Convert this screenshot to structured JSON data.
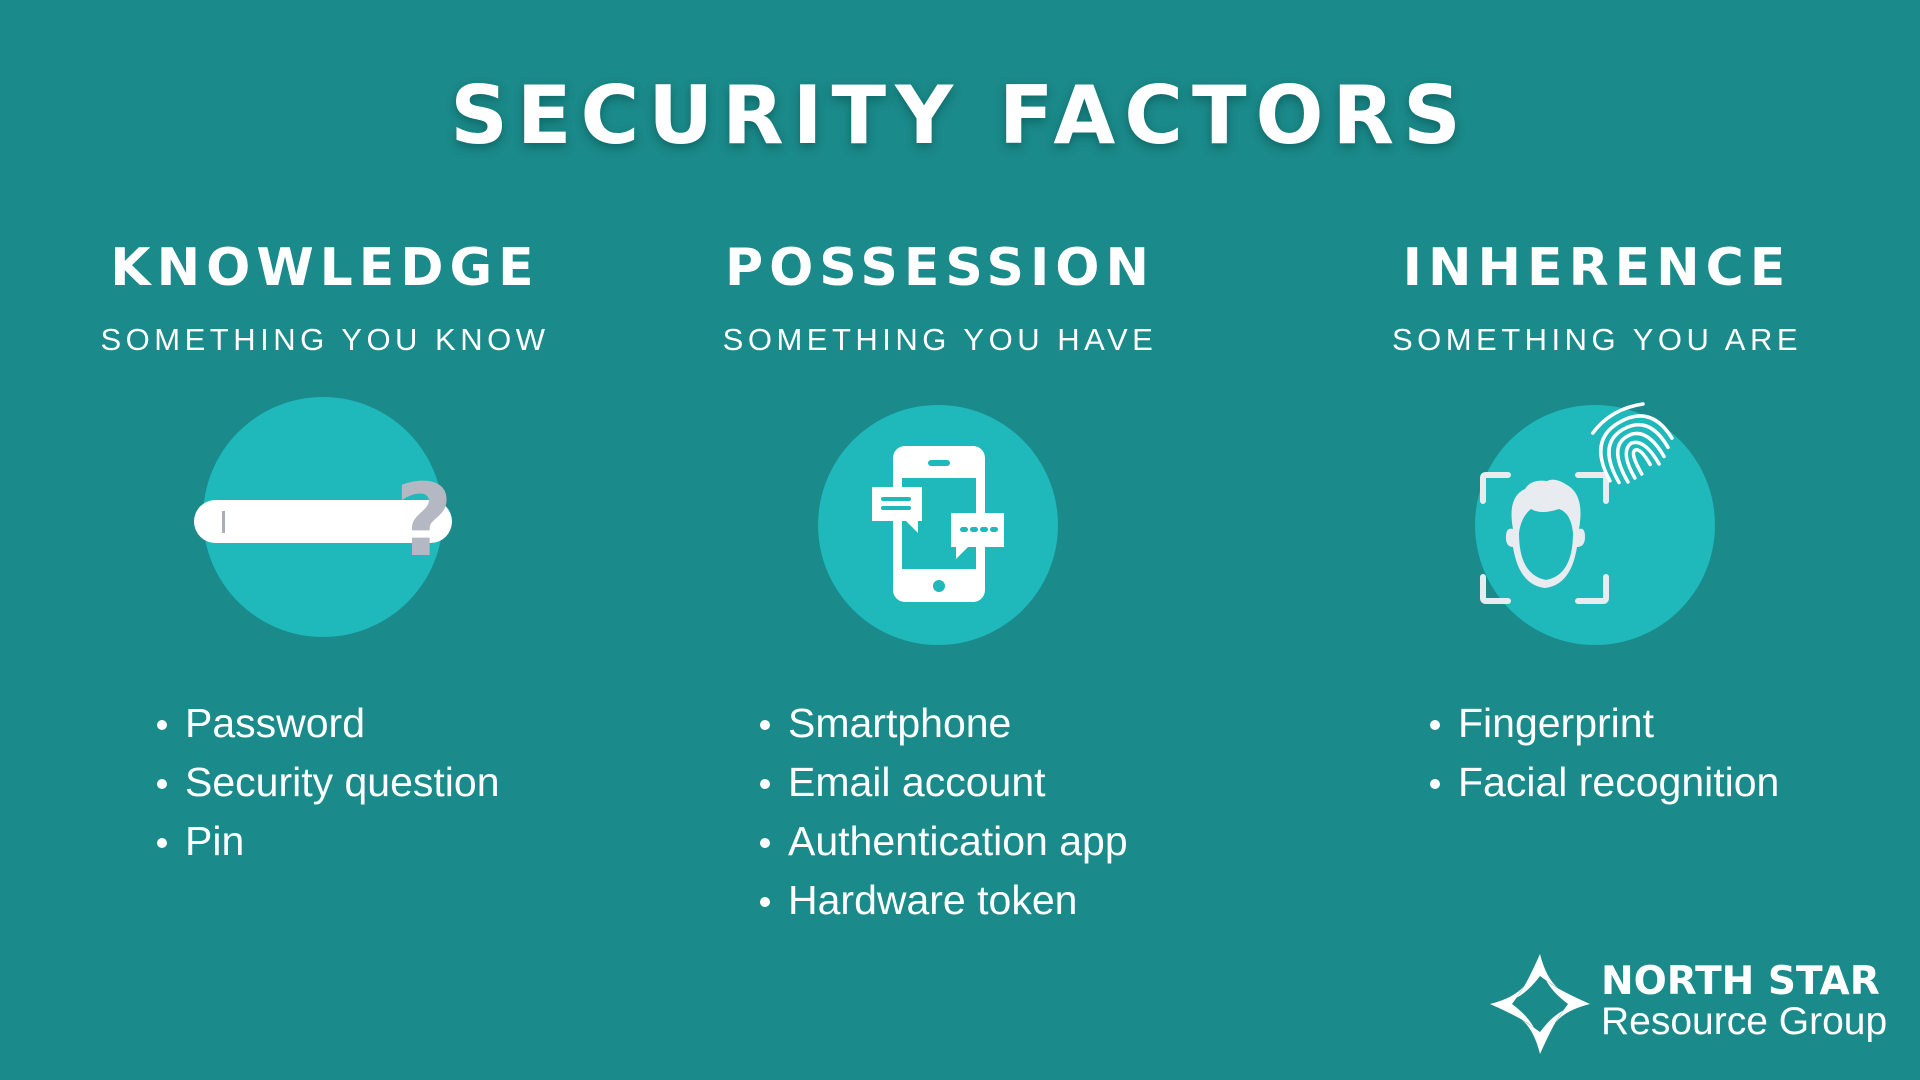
{
  "title": "SECURITY FACTORS",
  "colors": {
    "background": "#1b8a8a",
    "circle": "#1fb8bb",
    "text": "#ffffff",
    "question_mark": "#b3b8c2",
    "face": "#e8ecf0"
  },
  "columns": [
    {
      "heading": "KNOWLEDGE",
      "subheading": "SOMETHING YOU KNOW",
      "icon": "password-field-question-icon",
      "items": [
        "Password",
        "Security question",
        "Pin"
      ]
    },
    {
      "heading": "POSSESSION",
      "subheading": "SOMETHING YOU HAVE",
      "icon": "smartphone-chat-icon",
      "items": [
        "Smartphone",
        "Email account",
        "Authentication app",
        "Hardware token"
      ]
    },
    {
      "heading": "INHERENCE",
      "subheading": "SOMETHING YOU ARE",
      "icon": "face-fingerprint-icon",
      "items": [
        "Fingerprint",
        "Facial recognition"
      ]
    }
  ],
  "logo": {
    "icon": "north-star-icon",
    "name": "NORTH STAR",
    "tagline": "Resource Group"
  }
}
